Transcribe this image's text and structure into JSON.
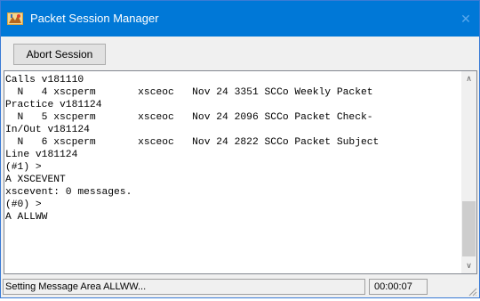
{
  "window": {
    "title": "Packet Session Manager",
    "close_glyph": "✕",
    "app_icon": "packet-radio-icon"
  },
  "toolbar": {
    "abort_label": "Abort Session"
  },
  "console": {
    "text": "Calls v181110\n  N   4 xscperm       xsceoc   Nov 24 3351 SCCo Weekly Packet\nPractice v181124\n  N   5 xscperm       xsceoc   Nov 24 2096 SCCo Packet Check-\nIn/Out v181124\n  N   6 xscperm       xsceoc   Nov 24 2822 SCCo Packet Subject\nLine v181124\n(#1) >\nA XSCEVENT\nxscevent: 0 messages.\n(#0) >\nA ALLWW",
    "scroll_up_glyph": "∧",
    "scroll_down_glyph": "∨"
  },
  "status": {
    "message": "Setting Message Area ALLWW...",
    "elapsed": "00:00:07"
  },
  "colors": {
    "titlebar": "#0078d7",
    "window_border": "#3a7bd5",
    "chrome": "#f0f0f0"
  }
}
